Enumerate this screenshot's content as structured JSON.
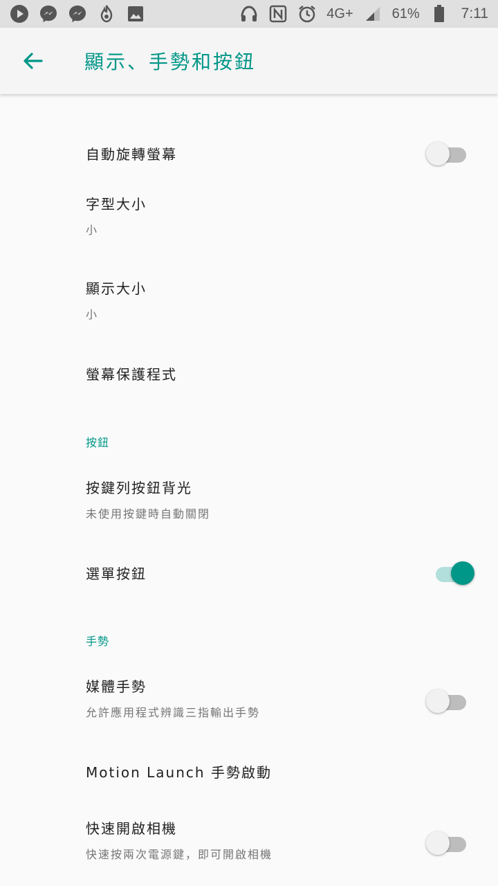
{
  "status_bar": {
    "left_icons": [
      "play-icon",
      "messenger-icon",
      "messenger-icon",
      "fire-app-icon",
      "image-icon"
    ],
    "right_icons": [
      "headphones-icon",
      "nfc-icon",
      "alarm-icon"
    ],
    "network": "4G+",
    "battery": "61%",
    "time": "7:11"
  },
  "app_bar": {
    "title": "顯示、手勢和按鈕"
  },
  "colors": {
    "accent": "#009688",
    "accent_light": "#b2dfdb"
  },
  "settings": {
    "auto_rotate": {
      "title": "自動旋轉螢幕",
      "enabled": false
    },
    "font_size": {
      "title": "字型大小",
      "summary": "小"
    },
    "display_size": {
      "title": "顯示大小",
      "summary": "小"
    },
    "screensaver": {
      "title": "螢幕保護程式"
    },
    "buttons_header": "按鈕",
    "key_backlight": {
      "title": "按鍵列按鈕背光",
      "summary": "未使用按鍵時自動關閉"
    },
    "menu_button": {
      "title": "選單按鈕",
      "enabled": true
    },
    "gestures_header": "手勢",
    "media_gestures": {
      "title": "媒體手勢",
      "summary": "允許應用程式辨識三指輸出手勢",
      "enabled": false
    },
    "motion_launch": {
      "title": "Motion Launch 手勢啟動"
    },
    "quick_camera": {
      "title": "快速開啟相機",
      "summary": "快速按兩次電源鍵，即可開啟相機",
      "enabled": false
    }
  }
}
